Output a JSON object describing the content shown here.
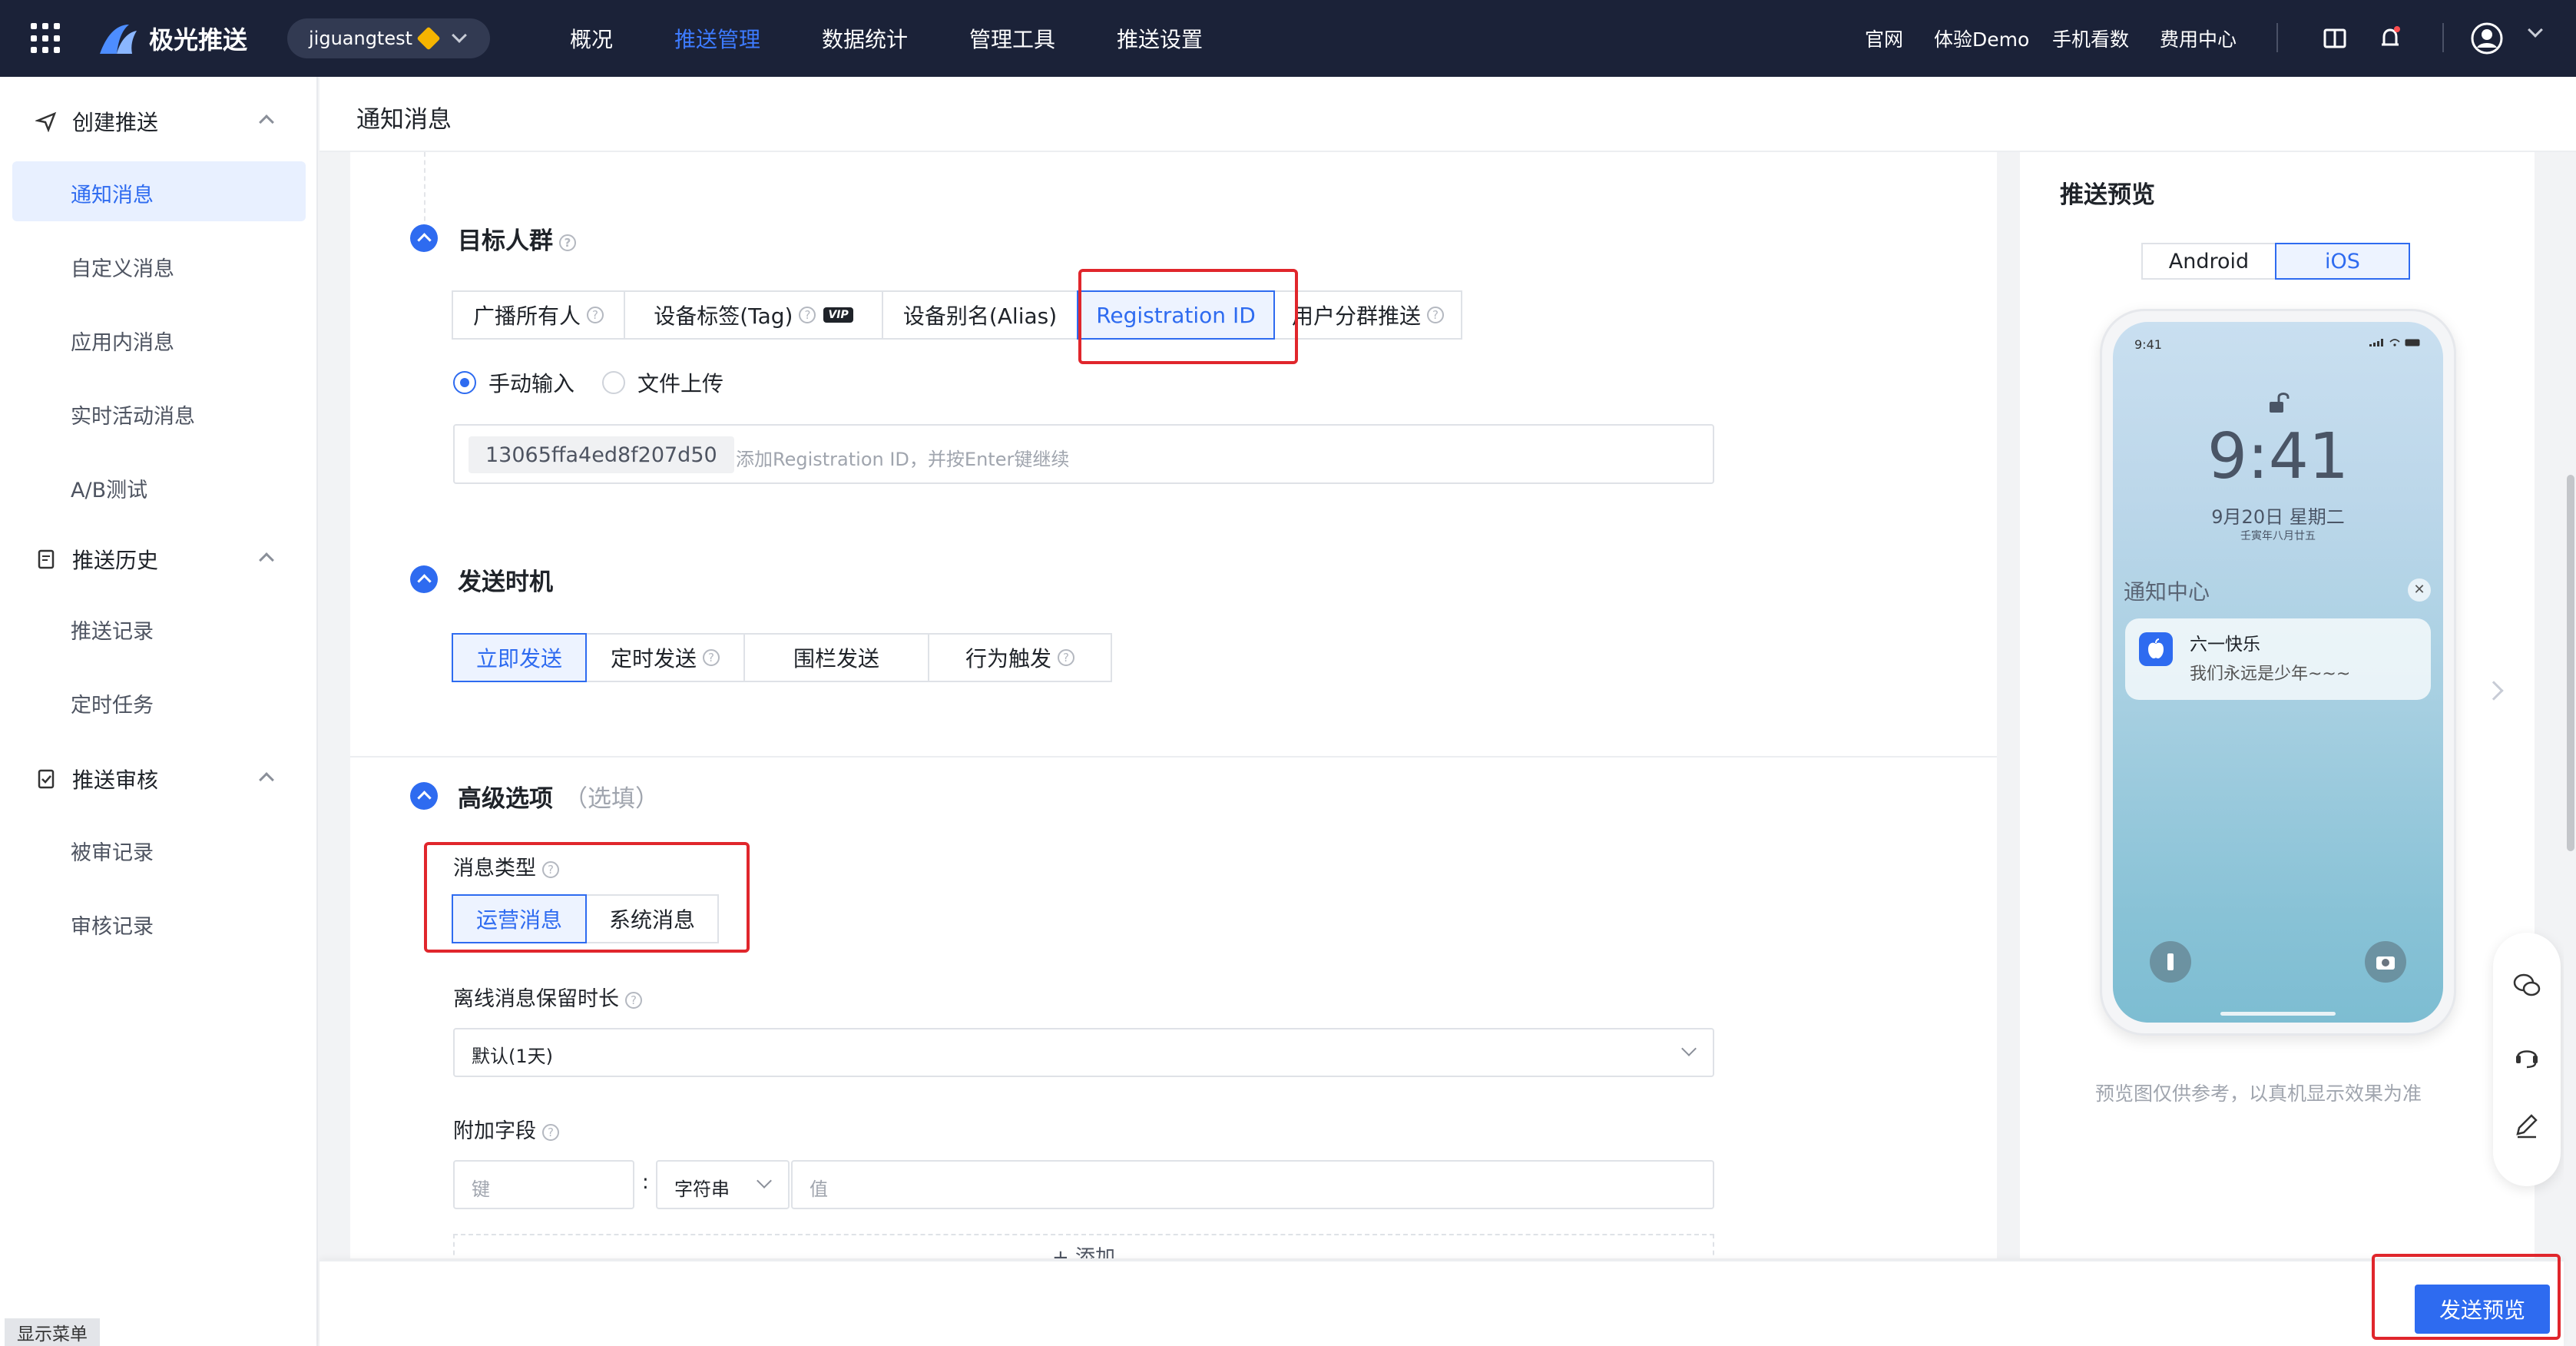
{
  "topbar": {
    "logo_text": "极光推送",
    "app_name": "jiguangtest",
    "nav": [
      "概况",
      "推送管理",
      "数据统计",
      "管理工具",
      "推送设置"
    ],
    "links": [
      "官网",
      "体验Demo",
      "手机看数",
      "费用中心"
    ]
  },
  "sidebar": {
    "groups": [
      {
        "label": "创建推送",
        "items": [
          "通知消息",
          "自定义消息",
          "应用内消息",
          "实时活动消息",
          "A/B测试"
        ]
      },
      {
        "label": "推送历史",
        "items": [
          "推送记录",
          "定时任务"
        ]
      },
      {
        "label": "推送审核",
        "items": [
          "被审记录",
          "审核记录"
        ]
      }
    ],
    "show_menu": "显示菜单"
  },
  "page": {
    "title": "通知消息"
  },
  "target": {
    "title": "目标人群",
    "tabs": [
      "广播所有人",
      "设备标签(Tag)",
      "设备别名(Alias)",
      "Registration ID",
      "用户分群推送"
    ],
    "vip": "VIP",
    "input_modes": [
      "手动输入",
      "文件上传"
    ],
    "reg_id": "13065ffa4ed8f207d50",
    "placeholder": "添加Registration ID，并按Enter键继续"
  },
  "timing": {
    "title": "发送时机",
    "tabs": [
      "立即发送",
      "定时发送",
      "围栏发送",
      "行为触发"
    ]
  },
  "advanced": {
    "title": "高级选项",
    "optional": "（选填）",
    "msg_type_label": "消息类型",
    "msg_types": [
      "运营消息",
      "系统消息"
    ],
    "offline_label": "离线消息保留时长",
    "offline_value": "默认(1天)",
    "extra_label": "附加字段",
    "key_placeholder": "键",
    "type_value": "字符串",
    "value_placeholder": "值",
    "add": "+ 添加"
  },
  "preview": {
    "title": "推送预览",
    "tabs": [
      "Android",
      "iOS"
    ],
    "status_time": "9:41",
    "big_time": "9:41",
    "date": "9月20日 星期二",
    "lunar": "壬寅年八月廿五",
    "nc_title": "通知中心",
    "notif_title": "六一快乐",
    "notif_body": "我们永远是少年~~~",
    "note": "预览图仅供参考，以真机显示效果为准"
  },
  "footer": {
    "send_preview": "发送预览"
  },
  "colors": {
    "accent": "#2e6bf0",
    "topbar": "#1b2238",
    "highlight": "#e0262c"
  }
}
